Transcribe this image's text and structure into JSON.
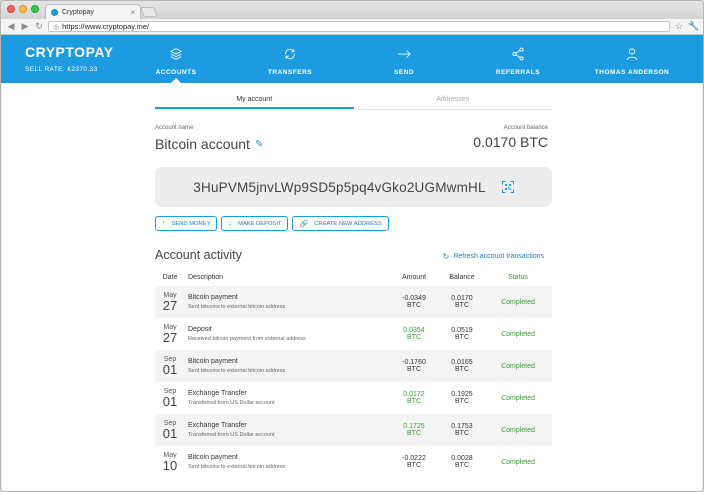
{
  "browser": {
    "tab_title": "Cryptopay",
    "tab_close": "×",
    "url": "https://www.cryptopay.me/"
  },
  "header": {
    "logo": "CRYPTOPAY",
    "sell_rate": "SELL RATE: €2370.33",
    "nav": [
      {
        "label": "ACCOUNTS",
        "icon": "stack-icon"
      },
      {
        "label": "TRANSFERS",
        "icon": "refresh-icon"
      },
      {
        "label": "SEND",
        "icon": "arrow-right-icon"
      },
      {
        "label": "REFERRALS",
        "icon": "share-icon"
      },
      {
        "label": "THOMAS ANDERSON",
        "icon": "user-icon"
      }
    ]
  },
  "subtabs": {
    "my_account": "My account",
    "addresses": "Addresses"
  },
  "account": {
    "name_label": "Account name",
    "name": "Bitcoin account",
    "balance_label": "Account balance",
    "balance": "0.0170 BTC",
    "address": "3HuPVM5jnvLWp9SD5p5pq4vGko2UGMwmHL"
  },
  "actions": {
    "send": "SEND MONEY",
    "deposit": "MAKE DEPOSIT",
    "new_address": "CREATE NEW ADDRESS"
  },
  "activity": {
    "title": "Account activity",
    "refresh": "Refresh account transactions",
    "columns": {
      "date": "Date",
      "description": "Description",
      "amount": "Amount",
      "balance": "Balance",
      "status": "Status"
    },
    "rows": [
      {
        "mon": "May",
        "day": "27",
        "title": "Bitcoin payment",
        "sub": "Sent bitcoins to external bitcoin address",
        "amount": "-0.0349",
        "unit": "BTC",
        "balance": "0.0170",
        "bunit": "BTC",
        "status": "Completed",
        "positive": false
      },
      {
        "mon": "May",
        "day": "27",
        "title": "Deposit",
        "sub": "Received bitcoin payment from external address",
        "amount": "0.0354",
        "unit": "BTC",
        "balance": "0.0519",
        "bunit": "BTC",
        "status": "Completed",
        "positive": true
      },
      {
        "mon": "Sep",
        "day": "01",
        "title": "Bitcoin payment",
        "sub": "Sent bitcoins to external bitcoin address",
        "amount": "-0.1760",
        "unit": "BTC",
        "balance": "0.0165",
        "bunit": "BTC",
        "status": "Completed",
        "positive": false
      },
      {
        "mon": "Sep",
        "day": "01",
        "title": "Exchange Transfer",
        "sub": "Transferred from US Dollar account",
        "amount": "0.0172",
        "unit": "BTC",
        "balance": "0.1925",
        "bunit": "BTC",
        "status": "Completed",
        "positive": true
      },
      {
        "mon": "Sep",
        "day": "01",
        "title": "Exchange Transfer",
        "sub": "Transferred from US Dollar account",
        "amount": "0.1725",
        "unit": "BTC",
        "balance": "0.1753",
        "bunit": "BTC",
        "status": "Completed",
        "positive": true
      },
      {
        "mon": "May",
        "day": "10",
        "title": "Bitcoin payment",
        "sub": "Sent bitcoins to external bitcoin address",
        "amount": "-0.0222",
        "unit": "BTC",
        "balance": "0.0028",
        "bunit": "BTC",
        "status": "Completed",
        "positive": false
      }
    ]
  },
  "colors": {
    "brand_blue": "#1c9be0",
    "positive_green": "#3a9a3a"
  }
}
